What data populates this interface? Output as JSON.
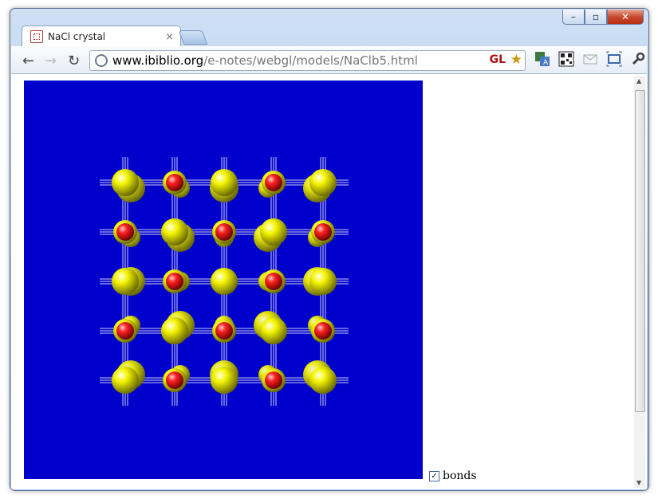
{
  "tab": {
    "title": "NaCl crystal",
    "close": "×"
  },
  "toolbar": {
    "url_host": "www.ibiblio.org",
    "url_path": "/e-notes/webgl/models/NaClb5.html",
    "gl_badge": "GL"
  },
  "page": {
    "bonds_label": "bonds",
    "bonds_checked": true
  },
  "colors": {
    "background": "#0000cc",
    "sodium": "#e41a1a",
    "chlorine": "#f2f200",
    "bond": "#ffffff"
  },
  "crystal": {
    "grid": [
      [
        "Cl",
        "Na",
        "Cl",
        "Na",
        "Cl"
      ],
      [
        "Na",
        "Cl",
        "Na",
        "Cl",
        "Na"
      ],
      [
        "Cl",
        "Na",
        "Cl",
        "Na",
        "Cl"
      ],
      [
        "Na",
        "Cl",
        "Na",
        "Cl",
        "Na"
      ],
      [
        "Cl",
        "Na",
        "Cl",
        "Na",
        "Cl"
      ]
    ]
  }
}
